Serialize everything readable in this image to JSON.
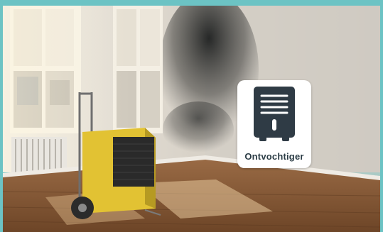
{
  "badge": {
    "icon": "dehumidifier-icon",
    "label": "Ontvochtiger"
  },
  "colors": {
    "frame": "#6cc3c4",
    "badge_icon": "#2f3b45",
    "dehumidifier_body": "#e2c233"
  }
}
